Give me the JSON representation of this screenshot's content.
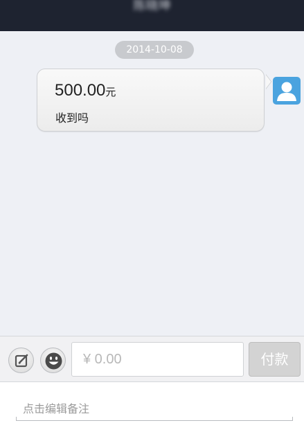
{
  "header": {
    "title": "陈晓坤"
  },
  "chat": {
    "date": "2014-10-08",
    "message": {
      "amount": "500.00",
      "currency": "元",
      "text": "收到吗"
    }
  },
  "input_bar": {
    "amount_placeholder": "¥ 0.00",
    "pay_label": "付款"
  },
  "remark": {
    "placeholder": "点击编辑备注"
  },
  "icons": {
    "edit": "edit-icon",
    "emoji": "smiley-icon",
    "avatar": "user-icon"
  },
  "colors": {
    "header_bg": "#1e2330",
    "chat_bg": "#eef0f5",
    "avatar_bg": "#4aa3df",
    "pay_disabled": "#d3d3d3"
  }
}
